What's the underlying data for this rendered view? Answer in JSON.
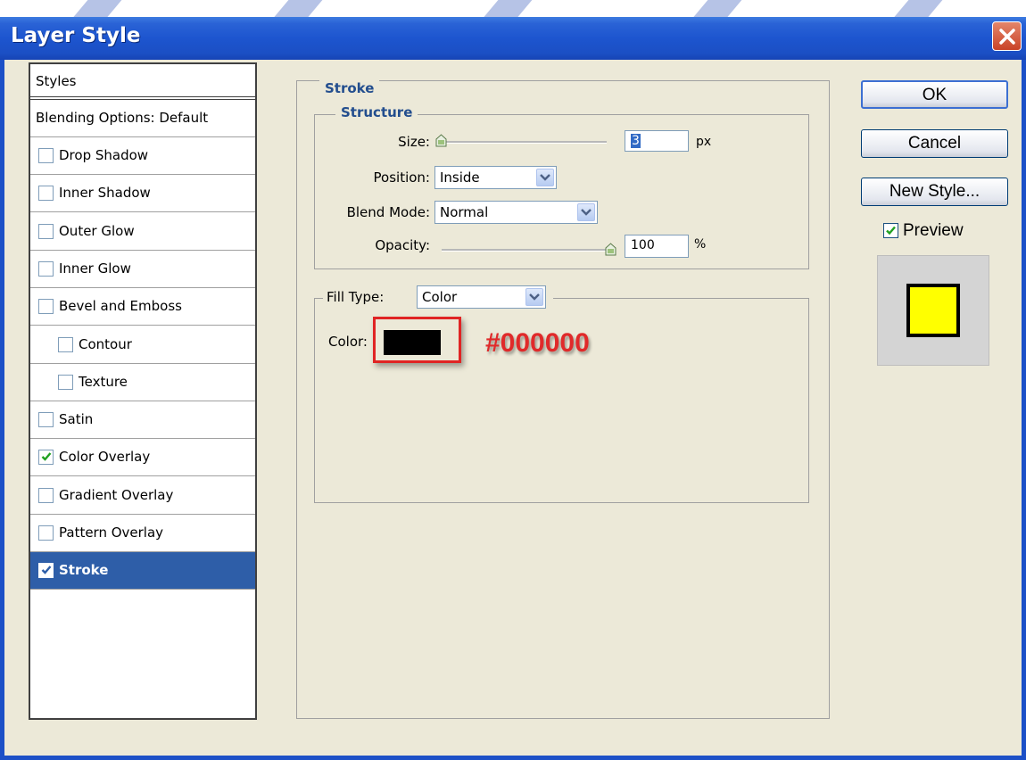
{
  "window": {
    "title": "Layer Style"
  },
  "styles_panel": {
    "header": "Styles",
    "blending_options": "Blending Options: Default",
    "items": [
      {
        "label": "Drop Shadow",
        "checked": false,
        "selected": false,
        "indent": false
      },
      {
        "label": "Inner Shadow",
        "checked": false,
        "selected": false,
        "indent": false
      },
      {
        "label": "Outer Glow",
        "checked": false,
        "selected": false,
        "indent": false
      },
      {
        "label": "Inner Glow",
        "checked": false,
        "selected": false,
        "indent": false
      },
      {
        "label": "Bevel and Emboss",
        "checked": false,
        "selected": false,
        "indent": false
      },
      {
        "label": "Contour",
        "checked": false,
        "selected": false,
        "indent": true
      },
      {
        "label": "Texture",
        "checked": false,
        "selected": false,
        "indent": true
      },
      {
        "label": "Satin",
        "checked": false,
        "selected": false,
        "indent": false
      },
      {
        "label": "Color Overlay",
        "checked": true,
        "selected": false,
        "indent": false
      },
      {
        "label": "Gradient Overlay",
        "checked": false,
        "selected": false,
        "indent": false
      },
      {
        "label": "Pattern Overlay",
        "checked": false,
        "selected": false,
        "indent": false
      },
      {
        "label": "Stroke",
        "checked": true,
        "selected": true,
        "indent": false
      }
    ]
  },
  "stroke": {
    "section_title": "Stroke",
    "structure_title": "Structure",
    "size": {
      "label": "Size:",
      "value": "3",
      "unit": "px"
    },
    "position": {
      "label": "Position:",
      "value": "Inside"
    },
    "blend_mode": {
      "label": "Blend Mode:",
      "value": "Normal"
    },
    "opacity": {
      "label": "Opacity:",
      "value": "100",
      "unit": "%"
    },
    "fill_type": {
      "label": "Fill Type:",
      "value": "Color"
    },
    "color": {
      "label": "Color:",
      "value": "#000000"
    },
    "annotation": "#000000"
  },
  "buttons": {
    "ok": "OK",
    "cancel": "Cancel",
    "new_style": "New Style..."
  },
  "preview": {
    "label": "Preview",
    "checked": true,
    "fill_color": "#ffff00",
    "stroke_color": "#000000"
  },
  "colors": {
    "titlebar": "#1d55cf",
    "selected_row": "#2e5ea8",
    "section_heading": "#234e8e",
    "annotation": "#e02a2a"
  }
}
